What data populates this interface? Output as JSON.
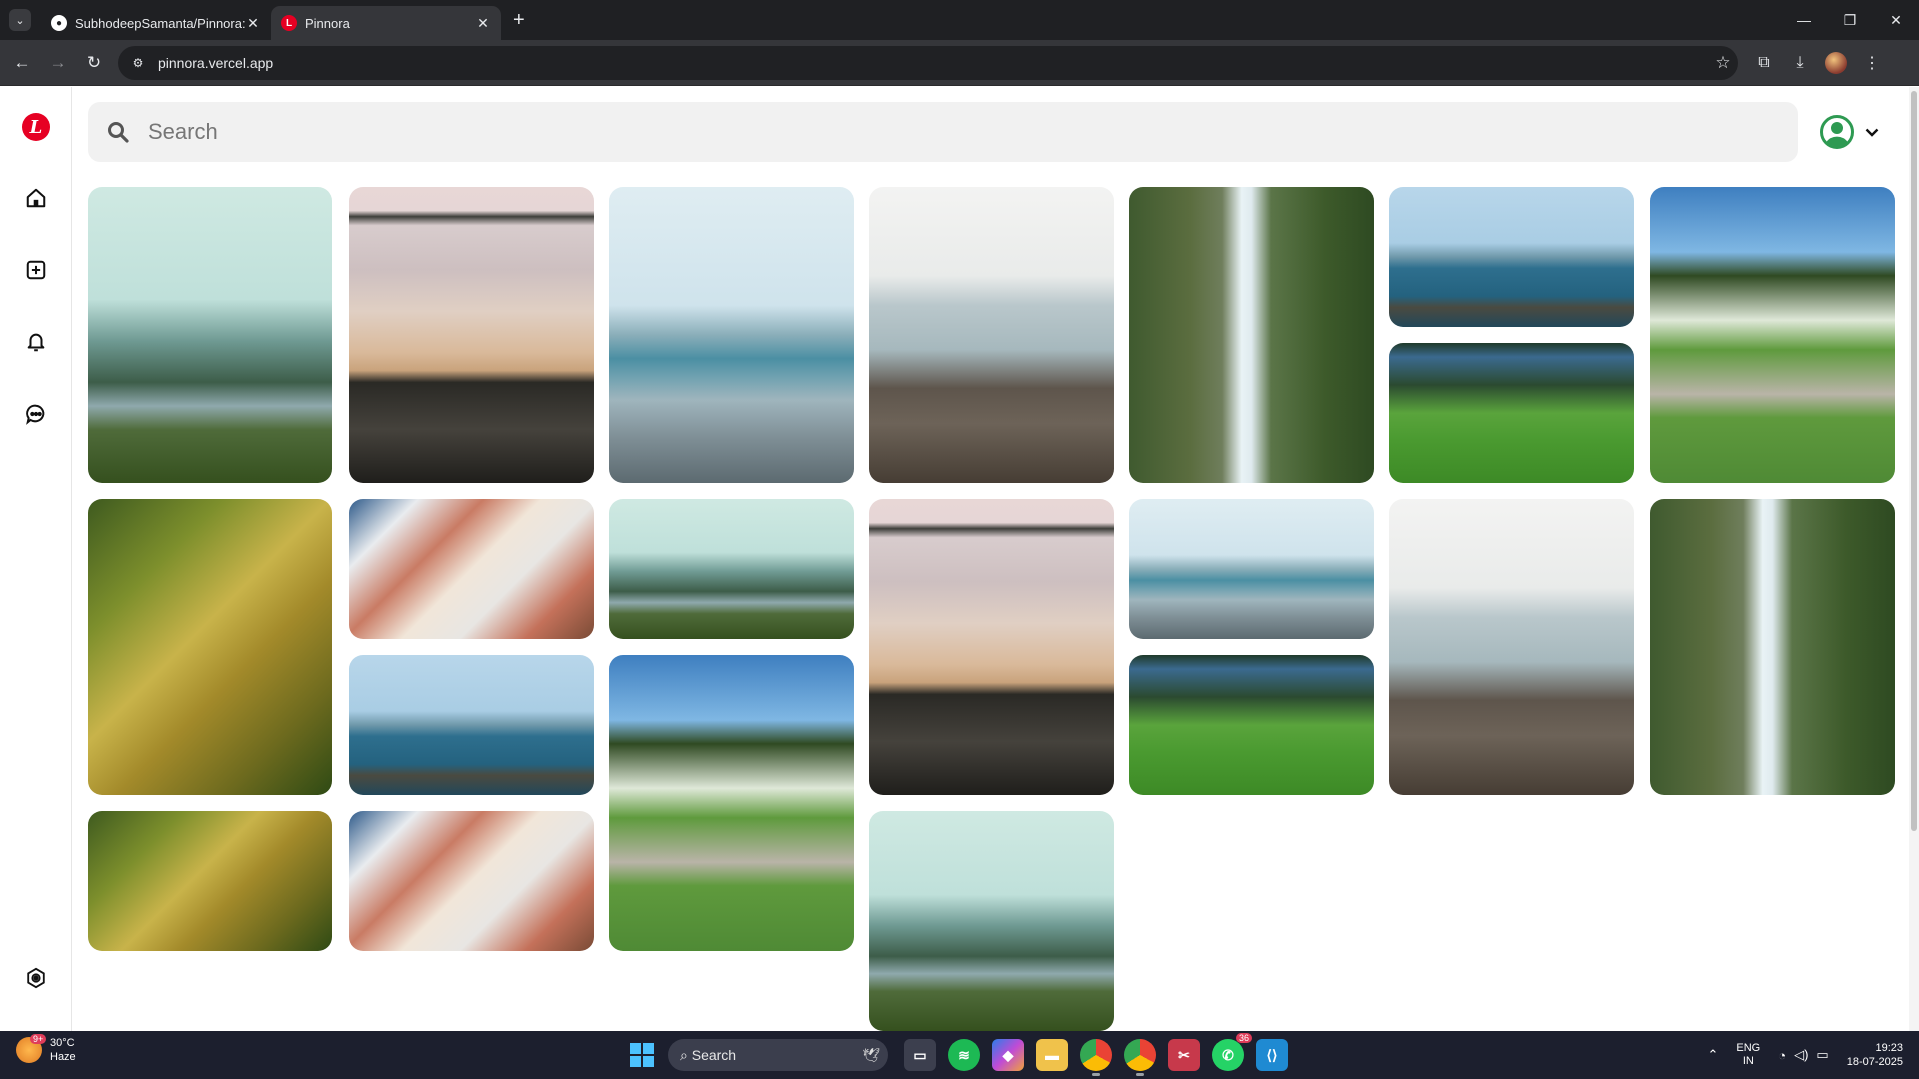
{
  "browser": {
    "tabs": [
      {
        "title": "SubhodeepSamanta/Pinnora: P",
        "icon": "github-icon",
        "active": false
      },
      {
        "title": "Pinnora",
        "icon": "pinnora-logo-icon",
        "active": true
      }
    ],
    "url": "pinnora.vercel.app"
  },
  "app": {
    "logo_letter": "L",
    "sidebar": [
      "home-icon",
      "create-icon",
      "notifications-icon",
      "messages-icon",
      "settings-icon"
    ],
    "search_placeholder": "Search",
    "accent_color": "#e60023"
  },
  "pins": [
    {
      "name": "pin-misty-valley",
      "scene": "valley"
    },
    {
      "name": "pin-beach-rocks",
      "scene": "beachrocks"
    },
    {
      "name": "pin-pebble-shore",
      "scene": "pebble"
    },
    {
      "name": "pin-rocky-sea",
      "scene": "rockysea"
    },
    {
      "name": "pin-waterfall",
      "scene": "waterfall"
    },
    {
      "name": "pin-sea-island",
      "scene": "seaisland"
    },
    {
      "name": "pin-forest-path",
      "scene": "path"
    },
    {
      "name": "pin-grass",
      "scene": "grass"
    },
    {
      "name": "pin-mossy-tree",
      "scene": "moss"
    },
    {
      "name": "pin-desk-flatlay",
      "scene": "desk"
    },
    {
      "name": "pin-misty-valley-2",
      "scene": "valley"
    },
    {
      "name": "pin-beach-rocks-2",
      "scene": "beachrocks"
    },
    {
      "name": "pin-pebble-shore-2",
      "scene": "pebble"
    },
    {
      "name": "pin-rocky-sea-2",
      "scene": "rockysea"
    },
    {
      "name": "pin-waterfall-2",
      "scene": "waterfall"
    },
    {
      "name": "pin-sea-island-2",
      "scene": "seaisland"
    },
    {
      "name": "pin-forest-path-2",
      "scene": "path"
    },
    {
      "name": "pin-grass-2",
      "scene": "grass"
    },
    {
      "name": "pin-mossy-tree-2",
      "scene": "moss"
    },
    {
      "name": "pin-desk-flatlay-2",
      "scene": "desk"
    },
    {
      "name": "pin-misty-valley-3",
      "scene": "valley"
    }
  ],
  "taskbar": {
    "weather_temp": "30°C",
    "weather_desc": "Haze",
    "weather_badge": "9+",
    "search_label": "Search",
    "whatsapp_count": "36",
    "lang_top": "ENG",
    "lang_bottom": "IN",
    "time": "19:23",
    "date": "18-07-2025"
  }
}
